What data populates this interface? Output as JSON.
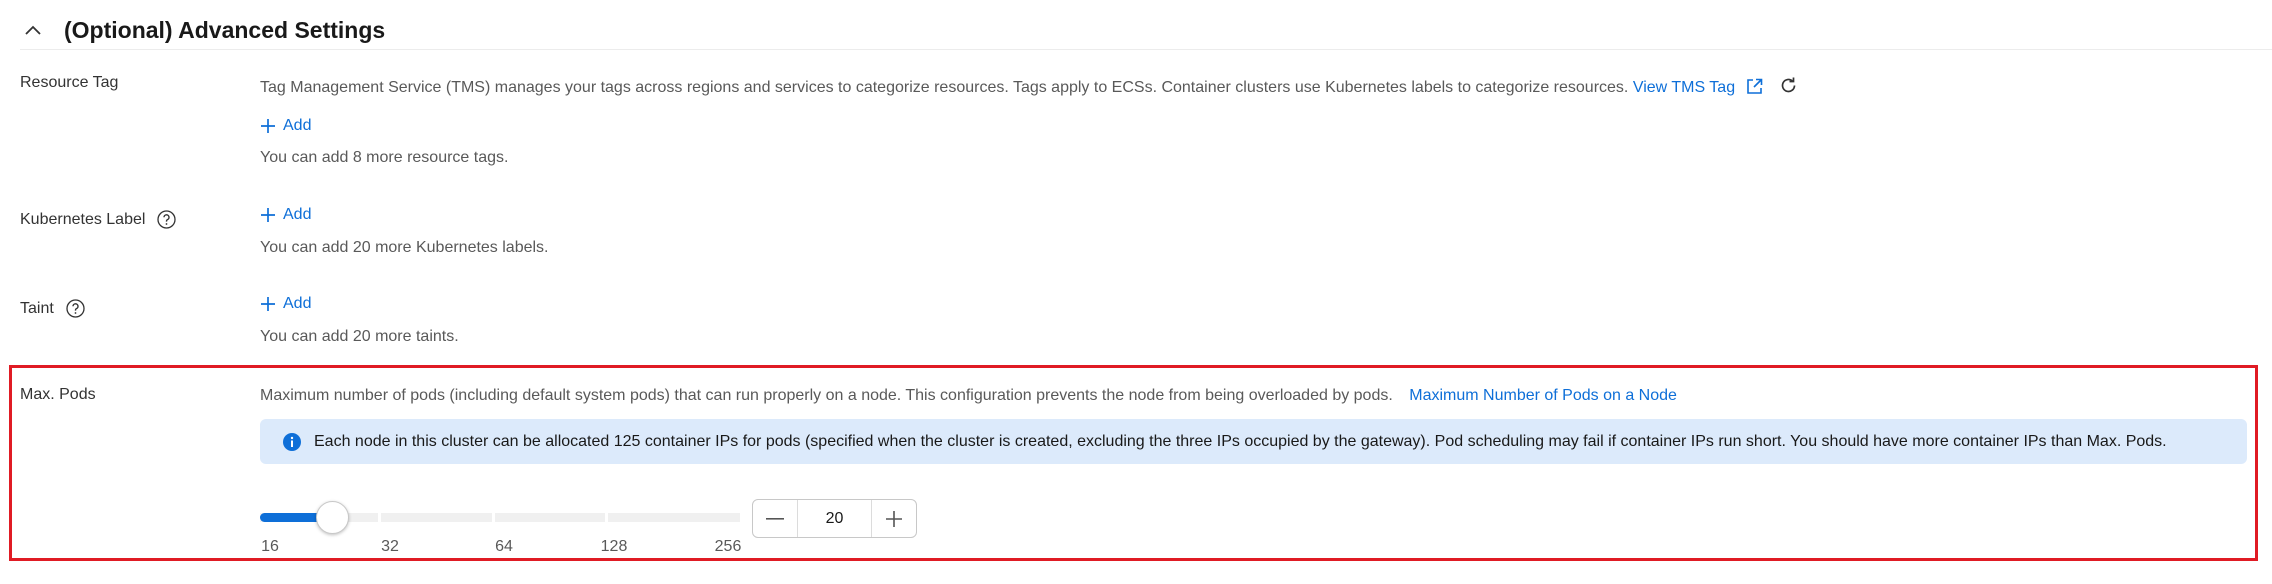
{
  "section": {
    "title": "(Optional) Advanced Settings"
  },
  "resource_tag": {
    "label": "Resource Tag",
    "description": "Tag Management Service (TMS) manages your tags across regions and services to categorize resources. Tags apply to ECSs. Container clusters use Kubernetes labels to categorize resources.",
    "link": "View TMS Tag",
    "add_label": "Add",
    "hint": "You can add 8 more resource tags."
  },
  "kubernetes_label": {
    "label": "Kubernetes Label",
    "add_label": "Add",
    "hint": "You can add 20 more Kubernetes labels."
  },
  "taint": {
    "label": "Taint",
    "add_label": "Add",
    "hint": "You can add 20 more taints."
  },
  "max_pods": {
    "label": "Max. Pods",
    "description": "Maximum number of pods (including default system pods) that can run properly on a node. This configuration prevents the node from being overloaded by pods.",
    "link": "Maximum Number of Pods on a Node",
    "info": "Each node in this cluster can be allocated 125 container IPs for pods (specified when the cluster is created, excluding the three IPs occupied by the gateway). Pod scheduling may fail if container IPs run short. You should have more container IPs than Max. Pods.",
    "slider_ticks": [
      "16",
      "32",
      "64",
      "128",
      "256"
    ],
    "slider_value": 20,
    "value": "20"
  },
  "colors": {
    "accent": "#0e6fd8",
    "info_bg": "#dceafb",
    "highlight": "#e01b24"
  }
}
